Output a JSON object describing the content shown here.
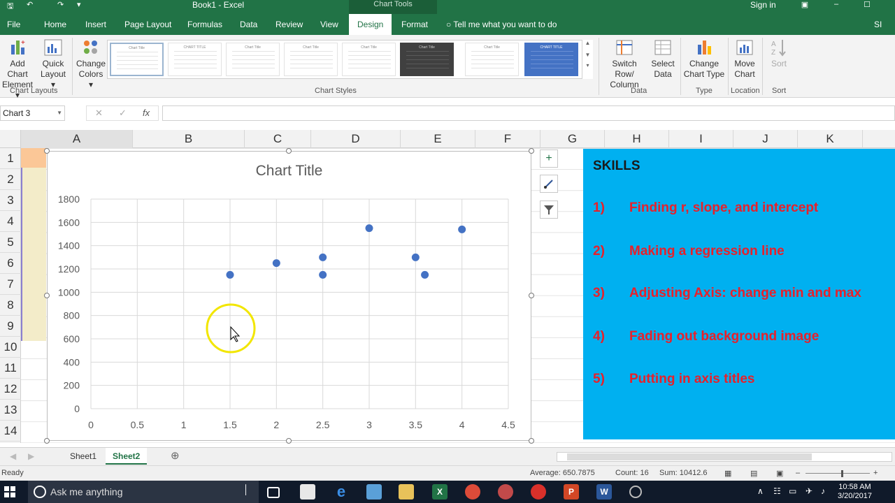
{
  "window": {
    "title": "Book1 - Excel",
    "context_tab": "Chart Tools",
    "signin": "Sign in"
  },
  "tabs": [
    "File",
    "Home",
    "Insert",
    "Page Layout",
    "Formulas",
    "Data",
    "Review",
    "View",
    "Design",
    "Format"
  ],
  "active_tab": "Design",
  "tell_me": "Tell me what you want to do",
  "user_initials": "SI",
  "ribbon": {
    "add_chart_element": [
      "Add Chart",
      "Element ▾"
    ],
    "quick_layout": [
      "Quick",
      "Layout ▾"
    ],
    "change_colors": [
      "Change",
      "Colors ▾"
    ],
    "switch_row_col": [
      "Switch Row/",
      "Column"
    ],
    "select_data": [
      "Select",
      "Data"
    ],
    "change_chart_type": [
      "Change",
      "Chart Type"
    ],
    "move_chart": [
      "Move",
      "Chart"
    ],
    "sort": "Sort",
    "sort2": "Sort",
    "groups": {
      "chart_layouts": "Chart Layouts",
      "chart_styles": "Chart Styles",
      "data": "Data",
      "type": "Type",
      "location": "Location",
      "sort": "Sort"
    },
    "style_thumb_labels": [
      "Chart Title",
      "CHART TITLE",
      "Chart Title",
      "Chart Title",
      "Chart Title",
      "Chart Title",
      "Chart Title",
      "CHART TITLE"
    ]
  },
  "formula_bar": {
    "name_box": "Chart 3",
    "cancel": "✕",
    "enter": "✓",
    "fx": "fx",
    "formula": ""
  },
  "columns": [
    "A",
    "B",
    "C",
    "D",
    "E",
    "F",
    "G",
    "H",
    "I",
    "J",
    "K"
  ],
  "rows": [
    "1",
    "2",
    "3",
    "4",
    "5",
    "6",
    "7",
    "8",
    "9",
    "10",
    "11",
    "12",
    "13",
    "14"
  ],
  "chart_data": {
    "type": "scatter",
    "title": "Chart Title",
    "x": [
      1.5,
      2,
      2.5,
      2.5,
      3,
      3.5,
      3.6,
      4
    ],
    "y": [
      1150,
      1250,
      1300,
      1150,
      1550,
      1300,
      1150,
      1540
    ],
    "xlim": [
      0,
      4.5
    ],
    "ylim": [
      0,
      1800
    ],
    "x_ticks": [
      "0",
      "0.5",
      "1",
      "1.5",
      "2",
      "2.5",
      "3",
      "3.5",
      "4",
      "4.5"
    ],
    "y_ticks": [
      "0",
      "200",
      "400",
      "600",
      "800",
      "1000",
      "1200",
      "1400",
      "1600",
      "1800"
    ],
    "grid": true,
    "marker_color": "#4472c4"
  },
  "skills": {
    "heading": "SKILLS",
    "items": [
      {
        "num": "1)",
        "text": "Finding r, slope, and intercept"
      },
      {
        "num": "2)",
        "text": "Making a regression line"
      },
      {
        "num": "3)",
        "text": "Adjusting Axis: change min and max"
      },
      {
        "num": "4)",
        "text": "Fading out background image"
      },
      {
        "num": "5)",
        "text": "Putting in axis titles"
      }
    ]
  },
  "sheets": [
    "Sheet1",
    "Sheet2"
  ],
  "active_sheet": "Sheet2",
  "status": {
    "ready": "Ready",
    "average": "Average: 650.7875",
    "count": "Count: 16",
    "sum": "Sum: 10412.6"
  },
  "taskbar": {
    "search": "Ask me anything",
    "time": "10:58 AM",
    "date": "3/20/2017"
  },
  "colors": {
    "excel_green": "#217346",
    "skills_bg": "#00b0f0",
    "skills_text": "#e8202a"
  }
}
